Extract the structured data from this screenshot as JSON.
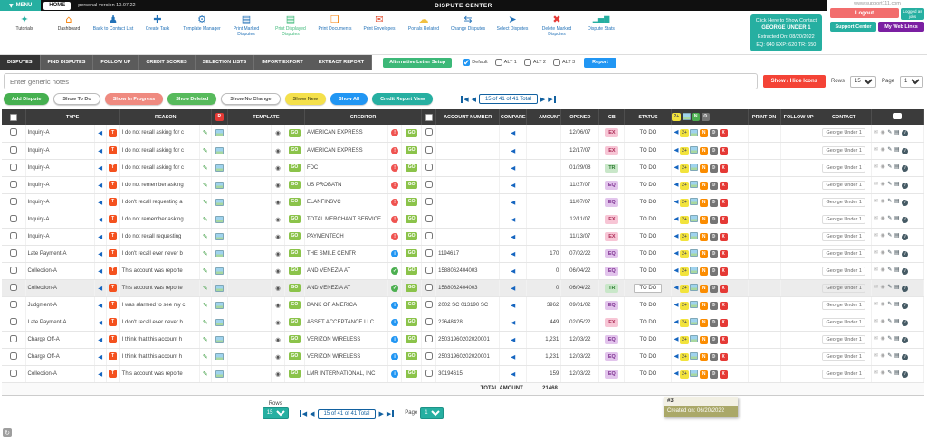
{
  "top_bar": {
    "menu": "MENU",
    "home": "HOME",
    "version": "personal version 10.07.22",
    "title": "DISPUTE CENTER",
    "site": "www.support111.com",
    "logout": "Logout",
    "logged_as": "Logged as jobs",
    "support_center": "Support Center",
    "my_web_links": "My Web Links"
  },
  "toolbar": {
    "items": [
      {
        "label": "Tutorials",
        "icon": "graduation-cap-icon",
        "color": "#26afa1",
        "label_color": "#333333"
      },
      {
        "label": "Dashboard",
        "icon": "home-icon",
        "color": "#f57c00",
        "label_color": "#333333"
      },
      {
        "label": "Back to Contact List",
        "icon": "person-icon",
        "color": "#2372b8",
        "label_color": "#2372b8"
      },
      {
        "label": "Create Task",
        "icon": "create-task-icon",
        "color": "#2372b8",
        "label_color": "#2372b8"
      },
      {
        "label": "Template Manager",
        "icon": "gear-icon",
        "color": "#2372b8",
        "label_color": "#2372b8"
      },
      {
        "label": "Print Marked Disputes",
        "icon": "printer-icon",
        "color": "#2372b8",
        "label_color": "#2372b8"
      },
      {
        "label": "Print Displayed Disputes",
        "icon": "printer-icon",
        "color": "#3cb878",
        "label_color": "#3cb878"
      },
      {
        "label": "Print Documents",
        "icon": "document-icon",
        "color": "#f57c00",
        "label_color": "#2372b8"
      },
      {
        "label": "Print Envelopes",
        "icon": "envelope-icon",
        "color": "#e35336",
        "label_color": "#2372b8"
      },
      {
        "label": "Portals Related",
        "icon": "cloud-icon",
        "color": "#f2c040",
        "label_color": "#2372b8"
      },
      {
        "label": "Change Disputes",
        "icon": "change-arrows-icon",
        "color": "#2372b8",
        "label_color": "#2372b8"
      },
      {
        "label": "Select Disputes",
        "icon": "select-cursor-icon",
        "color": "#2372b8",
        "label_color": "#2372b8"
      },
      {
        "label": "Delete Marked Disputes",
        "icon": "delete-x-icon",
        "color": "#e53935",
        "label_color": "#2372b8"
      },
      {
        "label": "Dispute Stats",
        "icon": "bar-chart-icon",
        "color": "#26afa1",
        "label_color": "#2372b8"
      }
    ],
    "contact_box": {
      "line1": "Click Here to Show Contact",
      "line2": "GEORGE UNDER 1",
      "line3": "Extracted On: 08/20/2022",
      "line4": "EQ: 640   EXP: 620   TR: 650"
    }
  },
  "tabs": {
    "items": [
      "DISPUTES",
      "FIND DISPUTES",
      "FOLLOW UP",
      "CREDIT SCORES",
      "SELECTION LISTS",
      "IMPORT EXPORT",
      "EXTRACT REPORT"
    ],
    "active": "DISPUTES",
    "alt_letter_setup": "Alternative Letter Setup",
    "checkboxes": [
      {
        "label": "Default",
        "checked": true
      },
      {
        "label": "ALT 1",
        "checked": false
      },
      {
        "label": "ALT 2",
        "checked": false
      },
      {
        "label": "ALT 3",
        "checked": false
      }
    ],
    "report": "Report"
  },
  "notes_row": {
    "placeholder": "Enter generic notes",
    "show_hide": "Show / Hide Icons",
    "rows_label": "Rows",
    "rows_value": "15",
    "page_label": "Page",
    "page_value": "1"
  },
  "filters": {
    "buttons": [
      {
        "label": "Add Dispute",
        "bg": "#46b050",
        "fg": "#ffffff"
      },
      {
        "label": "Show To Do",
        "bg": "#ffffff",
        "fg": "#555555"
      },
      {
        "label": "Show In Progress",
        "bg": "#ef8a80",
        "fg": "#ffffff"
      },
      {
        "label": "Show Deleted",
        "bg": "#57ba5c",
        "fg": "#ffffff"
      },
      {
        "label": "Show No Change",
        "bg": "#ffffff",
        "fg": "#555555"
      },
      {
        "label": "Show New",
        "bg": "#f4e04b",
        "fg": "#66601e"
      },
      {
        "label": "Show All",
        "bg": "#2196f3",
        "fg": "#ffffff"
      },
      {
        "label": "Credit Report View",
        "bg": "#26afa1",
        "fg": "#ffffff"
      }
    ],
    "pagination": "15 of 41 of 41 Total"
  },
  "table": {
    "headers": {
      "type": "TYPE",
      "reason": "REASON",
      "template": "TEMPLATE",
      "creditor": "CREDITOR",
      "account": "ACCOUNT NUMBER",
      "compare": "COMPARE",
      "amount": "AMOUNT",
      "opened": "OPENED",
      "cb": "CB",
      "status": "STATUS",
      "print_on": "PRINT ON",
      "follow_up": "FOLLOW UP",
      "contact": "CONTACT"
    },
    "badges": {
      "t": "T",
      "go": "GO",
      "r": "R",
      "two_plus": "2+",
      "n": "N",
      "x": "X"
    },
    "rows": [
      {
        "type": "Inquiry-A",
        "reason": "I do not recall asking for c",
        "creditor": "AMERICAN EXPRESS",
        "badge": "alert",
        "account": "",
        "amount": "",
        "opened": "12/06/07",
        "cb": "EX",
        "status": "TO DO",
        "contact": "George Under 1"
      },
      {
        "type": "Inquiry-A",
        "reason": "I do not recall asking for c",
        "creditor": "AMERICAN EXPRESS",
        "badge": "alert",
        "account": "",
        "amount": "",
        "opened": "12/17/07",
        "cb": "EX",
        "status": "TO DO",
        "contact": "George Under 1"
      },
      {
        "type": "Inquiry-A",
        "reason": "I do not recall asking for c",
        "creditor": "FDC",
        "badge": "alert",
        "account": "",
        "amount": "",
        "opened": "01/29/08",
        "cb": "TR",
        "status": "TO DO",
        "contact": "George Under 1"
      },
      {
        "type": "Inquiry-A",
        "reason": "I do not remember asking",
        "creditor": "US PROBATN",
        "badge": "alert",
        "account": "",
        "amount": "",
        "opened": "11/27/07",
        "cb": "EQ",
        "status": "TO DO",
        "contact": "George Under 1"
      },
      {
        "type": "Inquiry-A",
        "reason": "I don't recall requesting a",
        "creditor": "ELANFINSVC",
        "badge": "alert",
        "account": "",
        "amount": "",
        "opened": "11/07/07",
        "cb": "EQ",
        "status": "TO DO",
        "contact": "George Under 1"
      },
      {
        "type": "Inquiry-A",
        "reason": "I do not remember asking",
        "creditor": "TOTAL MERCHANT SERVICE",
        "badge": "alert",
        "account": "",
        "amount": "",
        "opened": "12/11/07",
        "cb": "EX",
        "status": "TO DO",
        "contact": "George Under 1"
      },
      {
        "type": "Inquiry-A",
        "reason": "I do not recall requesting",
        "creditor": "PAYMENTECH",
        "badge": "alert",
        "account": "",
        "amount": "",
        "opened": "11/13/07",
        "cb": "EX",
        "status": "TO DO",
        "contact": "George Under 1"
      },
      {
        "type": "Late Payment-A",
        "reason": "I don't recall ever never b",
        "creditor": "THE SMILE CENTR",
        "badge": "info",
        "account": "1194617",
        "amount": "170",
        "opened": "07/02/22",
        "cb": "EQ",
        "status": "TO DO",
        "contact": "George Under 1"
      },
      {
        "type": "Collection-A",
        "reason": "This account was reporte",
        "creditor": "AND VENEZIA AT",
        "badge": "ok",
        "account": "1588062404003",
        "amount": "0",
        "opened": "06/04/22",
        "cb": "EQ",
        "status": "TO DO",
        "contact": "George Under 1"
      },
      {
        "type": "Collection-A",
        "reason": "This account was reporte",
        "creditor": "AND VENEZIA AT",
        "badge": "ok",
        "account": "1588062404003",
        "amount": "0",
        "opened": "06/04/22",
        "cb": "TR",
        "status": "TO DO",
        "contact": "George Under 1",
        "highlight": true
      },
      {
        "type": "Judgment-A",
        "reason": "I was alarmed to see my c",
        "creditor": "BANK OF AMERICA",
        "badge": "info",
        "account": "2002 SC 013190 SC",
        "amount": "3962",
        "opened": "09/01/02",
        "cb": "EQ",
        "status": "TO DO",
        "contact": "George Under 1"
      },
      {
        "type": "Late Payment-A",
        "reason": "I don't recall ever never b",
        "creditor": "ASSET ACCEPTANCE LLC",
        "badge": "info",
        "account": "22648428",
        "amount": "449",
        "opened": "02/05/22",
        "cb": "EX",
        "status": "TO DO",
        "contact": "George Under 1"
      },
      {
        "type": "Charge Off-A",
        "reason": "I think that this account h",
        "creditor": "VERIZON WIRELESS",
        "badge": "info",
        "account": "25031960202020001",
        "amount": "1,231",
        "opened": "12/03/22",
        "cb": "EQ",
        "status": "TO DO",
        "contact": "George Under 1"
      },
      {
        "type": "Charge Off-A",
        "reason": "I think that this account h",
        "creditor": "VERIZON WIRELESS",
        "badge": "info",
        "account": "25031960202020001",
        "amount": "1,231",
        "opened": "12/03/22",
        "cb": "EQ",
        "status": "TO DO",
        "contact": "George Under 1"
      },
      {
        "type": "Collection-A",
        "reason": "This account was reporte",
        "creditor": "LMR INTERNATIONAL, INC",
        "badge": "info",
        "account": "30194615",
        "amount": "159",
        "opened": "12/03/22",
        "cb": "EQ",
        "status": "TO DO",
        "contact": "George Under 1"
      }
    ],
    "total_label": "TOTAL AMOUNT",
    "total_value": "21468"
  },
  "tooltip": {
    "id": "#3",
    "created": "Created on: 06/20/2022"
  },
  "footer": {
    "rows_label": "Rows",
    "rows_value": "15",
    "pagination": "15 of 41 of 41 Total",
    "page_label": "Page",
    "page_value": "1"
  }
}
